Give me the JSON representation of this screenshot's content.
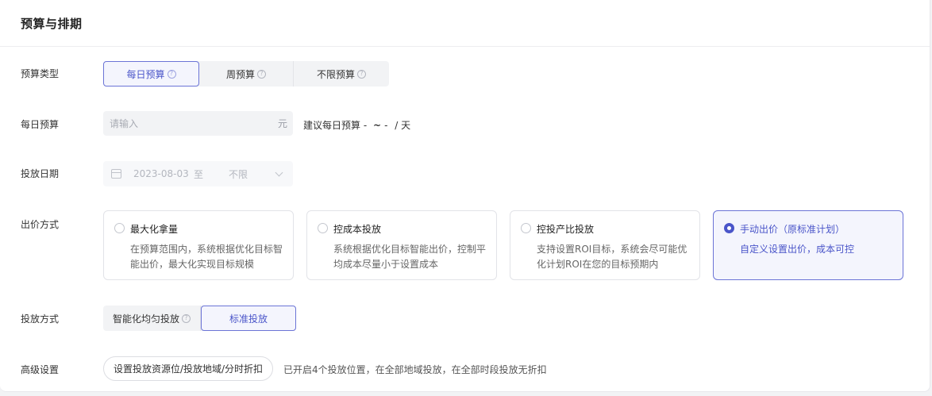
{
  "section": {
    "title": "预算与排期"
  },
  "budget_type": {
    "label": "预算类型",
    "options": [
      {
        "label": "每日预算",
        "help": "?"
      },
      {
        "label": "周预算",
        "help": "?"
      },
      {
        "label": "不限预算",
        "help": "?"
      }
    ],
    "selected": "每日预算"
  },
  "daily_budget": {
    "label": "每日预算",
    "value": "",
    "placeholder": "请输入",
    "unit": "元",
    "suggest_prefix": "建议每日预算",
    "suggest_min": "-",
    "suggest_sep": "~",
    "suggest_max": "-",
    "suggest_suffix": "/ 天"
  },
  "schedule": {
    "label": "投放日期",
    "start_date": "2023-08-03",
    "separator": "至",
    "end_date": "不限"
  },
  "bid_method": {
    "label": "出价方式",
    "options": [
      {
        "title": "最大化拿量",
        "desc": "在预算范围内，系统根据优化目标智能出价，最大化实现目标规模"
      },
      {
        "title": "控成本投放",
        "desc": "系统根据优化目标智能出价，控制平均成本尽量小于设置成本"
      },
      {
        "title": "控投产比投放",
        "desc": "支持设置ROI目标，系统会尽可能优化计划ROI在您的目标预期内"
      },
      {
        "title": "手动出价（原标准计划）",
        "desc": "自定义设置出价，成本可控"
      }
    ],
    "selected": "手动出价（原标准计划）"
  },
  "delivery_method": {
    "label": "投放方式",
    "options": [
      {
        "label": "智能化均匀投放",
        "help": "?"
      },
      {
        "label": "标准投放"
      }
    ],
    "selected": "标准投放"
  },
  "advanced": {
    "label": "高级设置",
    "button_label": "设置投放资源位/投放地域/分时折扣",
    "summary": "已开启4个投放位置，在全部地域投放，在全部时段投放无折扣"
  },
  "colors": {
    "accent": "#4a55c9",
    "accent_bg": "#f4f5fd",
    "accent_border": "#6b74d6"
  }
}
